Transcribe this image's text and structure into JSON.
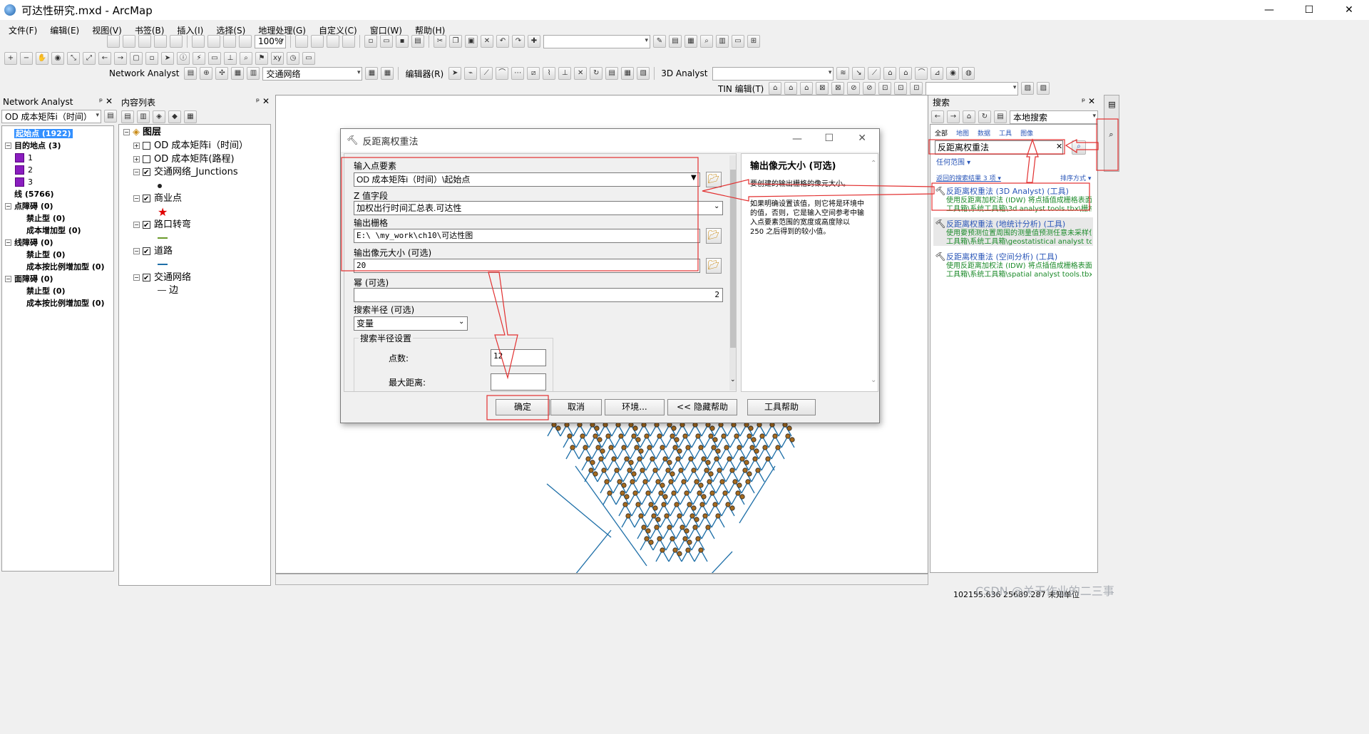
{
  "window": {
    "title": "可达性研究.mxd - ArcMap",
    "min": "—",
    "max": "☐",
    "close": "✕"
  },
  "menu": [
    "文件(F)",
    "编辑(E)",
    "视图(V)",
    "书签(B)",
    "插入(I)",
    "选择(S)",
    "地理处理(G)",
    "自定义(C)",
    "窗口(W)",
    "帮助(H)"
  ],
  "toolbar": {
    "zoom": "100%",
    "network_analyst": "Network Analyst",
    "network_dataset": "交通网络",
    "editor": "编辑器(R)",
    "analyst3d": "3D Analyst",
    "tin_edit": "TIN 编辑(T)"
  },
  "na_panel": {
    "title": "Network Analyst",
    "dropdown": "OD 成本矩阵i（时间）",
    "items": [
      {
        "label": "起始点 (1922)",
        "level": 0,
        "selected": true
      },
      {
        "label": "目的地点 (3)",
        "level": 0,
        "expand": "⊟"
      },
      {
        "label": "1",
        "level": 1,
        "swatch": true
      },
      {
        "label": "2",
        "level": 1,
        "swatch": true
      },
      {
        "label": "3",
        "level": 1,
        "swatch": true
      },
      {
        "label": "线 (5766)",
        "level": 0
      },
      {
        "label": "点障碍 (0)",
        "level": 0,
        "expand": "⊟"
      },
      {
        "label": "禁止型 (0)",
        "level": 2
      },
      {
        "label": "成本增加型 (0)",
        "level": 2
      },
      {
        "label": "线障碍 (0)",
        "level": 0,
        "expand": "⊟"
      },
      {
        "label": "禁止型 (0)",
        "level": 2
      },
      {
        "label": "成本按比例增加型 (0)",
        "level": 2
      },
      {
        "label": "面障碍 (0)",
        "level": 0,
        "expand": "⊟"
      },
      {
        "label": "禁止型 (0)",
        "level": 2
      },
      {
        "label": "成本按比例增加型 (0)",
        "level": 2
      }
    ]
  },
  "toc": {
    "title": "内容列表",
    "root": "图层",
    "layers": [
      {
        "label": "OD 成本矩阵i（时间）",
        "checked": false,
        "expand": "⊞"
      },
      {
        "label": "OD 成本矩阵(路程)",
        "checked": false,
        "expand": "⊞"
      },
      {
        "label": "交通网络_Junctions",
        "checked": true,
        "expand": "⊟",
        "symbol": "dot"
      },
      {
        "label": "商业点",
        "checked": true,
        "expand": "⊟",
        "symbol": "star"
      },
      {
        "label": "路口转弯",
        "checked": true,
        "expand": "⊟",
        "symbol": "greenline"
      },
      {
        "label": "道路",
        "checked": true,
        "expand": "⊟",
        "symbol": "blueline"
      },
      {
        "label": "交通网络",
        "checked": true,
        "expand": "⊟",
        "symbol": "edge",
        "sub": "边"
      }
    ]
  },
  "dialog": {
    "title": "反距离权重法",
    "input_points_label": "输入点要素",
    "input_points_value": "OD 成本矩阵i（时间）\\起始点",
    "z_field_label": "Z 值字段",
    "z_field_value": "加权出行时间汇总表.可达性",
    "output_raster_label": "输出栅格",
    "output_raster_value": "E:\\           \\my_work\\ch10\\可达性图",
    "cell_size_label": "输出像元大小 (可选)",
    "cell_size_value": "20",
    "power_label": "幂 (可选)",
    "power_value": "2",
    "search_radius_label": "搜索半径 (可选)",
    "search_radius_value": "变量",
    "search_settings_label": "搜索半径设置",
    "points_label": "点数:",
    "points_value": "12",
    "max_dist_label": "最大距离:",
    "max_dist_value": "",
    "ok": "确定",
    "cancel": "取消",
    "env": "环境...",
    "hide_help": "<< 隐藏帮助",
    "tool_help": "工具帮助",
    "help_title": "输出像元大小 (可选)",
    "help_p1": "要创建的输出栅格的像元大小。",
    "help_p2": "如果明确设置该值，则它将是环境中的值，否则，它是输入空间参考中输入点要素范围的宽度或高度除以 250 之后得到的较小值。"
  },
  "search": {
    "title": "搜索",
    "scope": "本地搜索",
    "tabs": [
      "全部",
      "地图",
      "数据",
      "工具",
      "图像"
    ],
    "query": "反距离权重法",
    "any_extent": "任何范围",
    "result_count": "返回的搜索结果 3 项",
    "sort": "排序方式",
    "results": [
      {
        "title": "反距离权重法 (3D Analyst) (工具)",
        "desc": "使用反距离加权法 (IDW) 将点插值成栅格表面。",
        "path": "工具箱\\系统工具箱\\3d analyst tools.tbx\\栅格..."
      },
      {
        "title": "反距离权重法 (地统计分析) (工具)",
        "desc": "使用要预测位置周围的测量值预测任意未采样位置...",
        "path": "工具箱\\系统工具箱\\geostatistical analyst tool..."
      },
      {
        "title": "反距离权重法 (空间分析) (工具)",
        "desc": "使用反距离加权法 (IDW) 将点插值成栅格表面。",
        "path": "工具箱\\系统工具箱\\spatial analyst tools.tbx\\..."
      }
    ]
  },
  "status": {
    "coords": "102155.636  25689.287 未知单位",
    "watermark": "CSDN @关于作业的二三事"
  },
  "colors": {
    "network_line": "#1e6fa8",
    "junction_fill": "#a56a1e",
    "highlight": "#e23030",
    "selection": "#3390ff"
  }
}
